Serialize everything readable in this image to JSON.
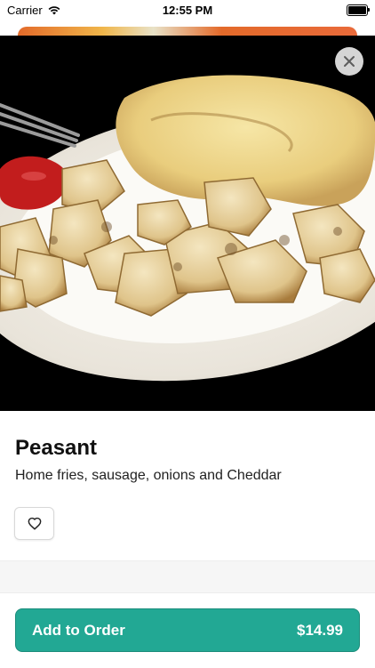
{
  "status_bar": {
    "carrier": "Carrier",
    "time": "12:55 PM"
  },
  "item": {
    "title": "Peasant",
    "description": "Home fries, sausage, onions and Cheddar"
  },
  "actions": {
    "close_icon": "close-icon",
    "favorite_icon": "heart-icon"
  },
  "order": {
    "button_label": "Add to Order",
    "price": "$14.99"
  },
  "colors": {
    "accent": "#22a894",
    "hero_background": "#000000"
  }
}
